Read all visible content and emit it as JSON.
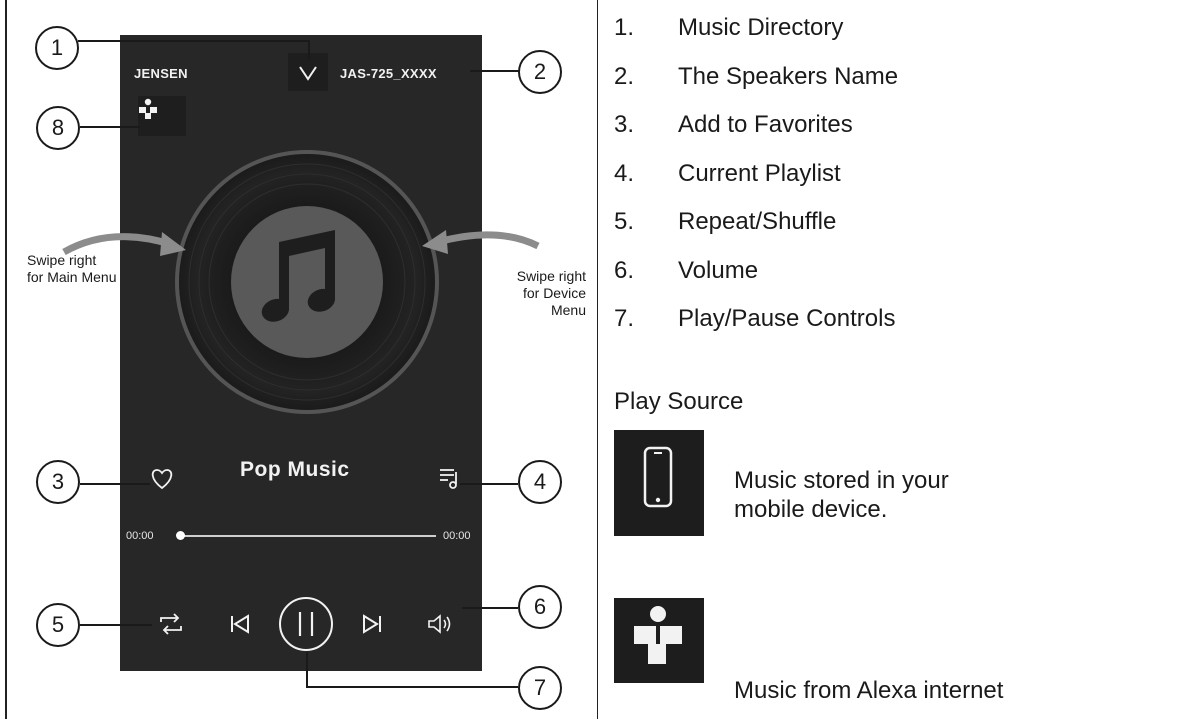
{
  "phone": {
    "brand": "JENSEN",
    "speaker_name": "JAS-725_XXXX",
    "song_title": "Pop Music",
    "time_start": "00:00",
    "time_end": "00:00",
    "progress": 0
  },
  "swipe_left": [
    "Swipe right",
    "for Main Menu"
  ],
  "swipe_right": [
    "Swipe right",
    "for Device",
    "Menu"
  ],
  "callouts": [
    "1",
    "2",
    "3",
    "4",
    "5",
    "6",
    "7",
    "8"
  ],
  "legend": [
    {
      "num": "1.",
      "text": "Music Directory"
    },
    {
      "num": "2.",
      "text": "The Speakers Name"
    },
    {
      "num": "3.",
      "text": "Add to Favorites"
    },
    {
      "num": "4.",
      "text": "Current Playlist"
    },
    {
      "num": "5.",
      "text": "Repeat/Shuffle"
    },
    {
      "num": "6.",
      "text": "Volume"
    },
    {
      "num": "7.",
      "text": "Play/Pause Controls"
    }
  ],
  "play_source": {
    "title": "Play Source",
    "mobile": [
      "Music stored in your",
      "mobile device."
    ],
    "alexa": "Music from Alexa internet"
  },
  "colors": {
    "phone_bg": "#272727",
    "icon_bg": "#1d1d1d",
    "vinyl_center": "#595959"
  }
}
